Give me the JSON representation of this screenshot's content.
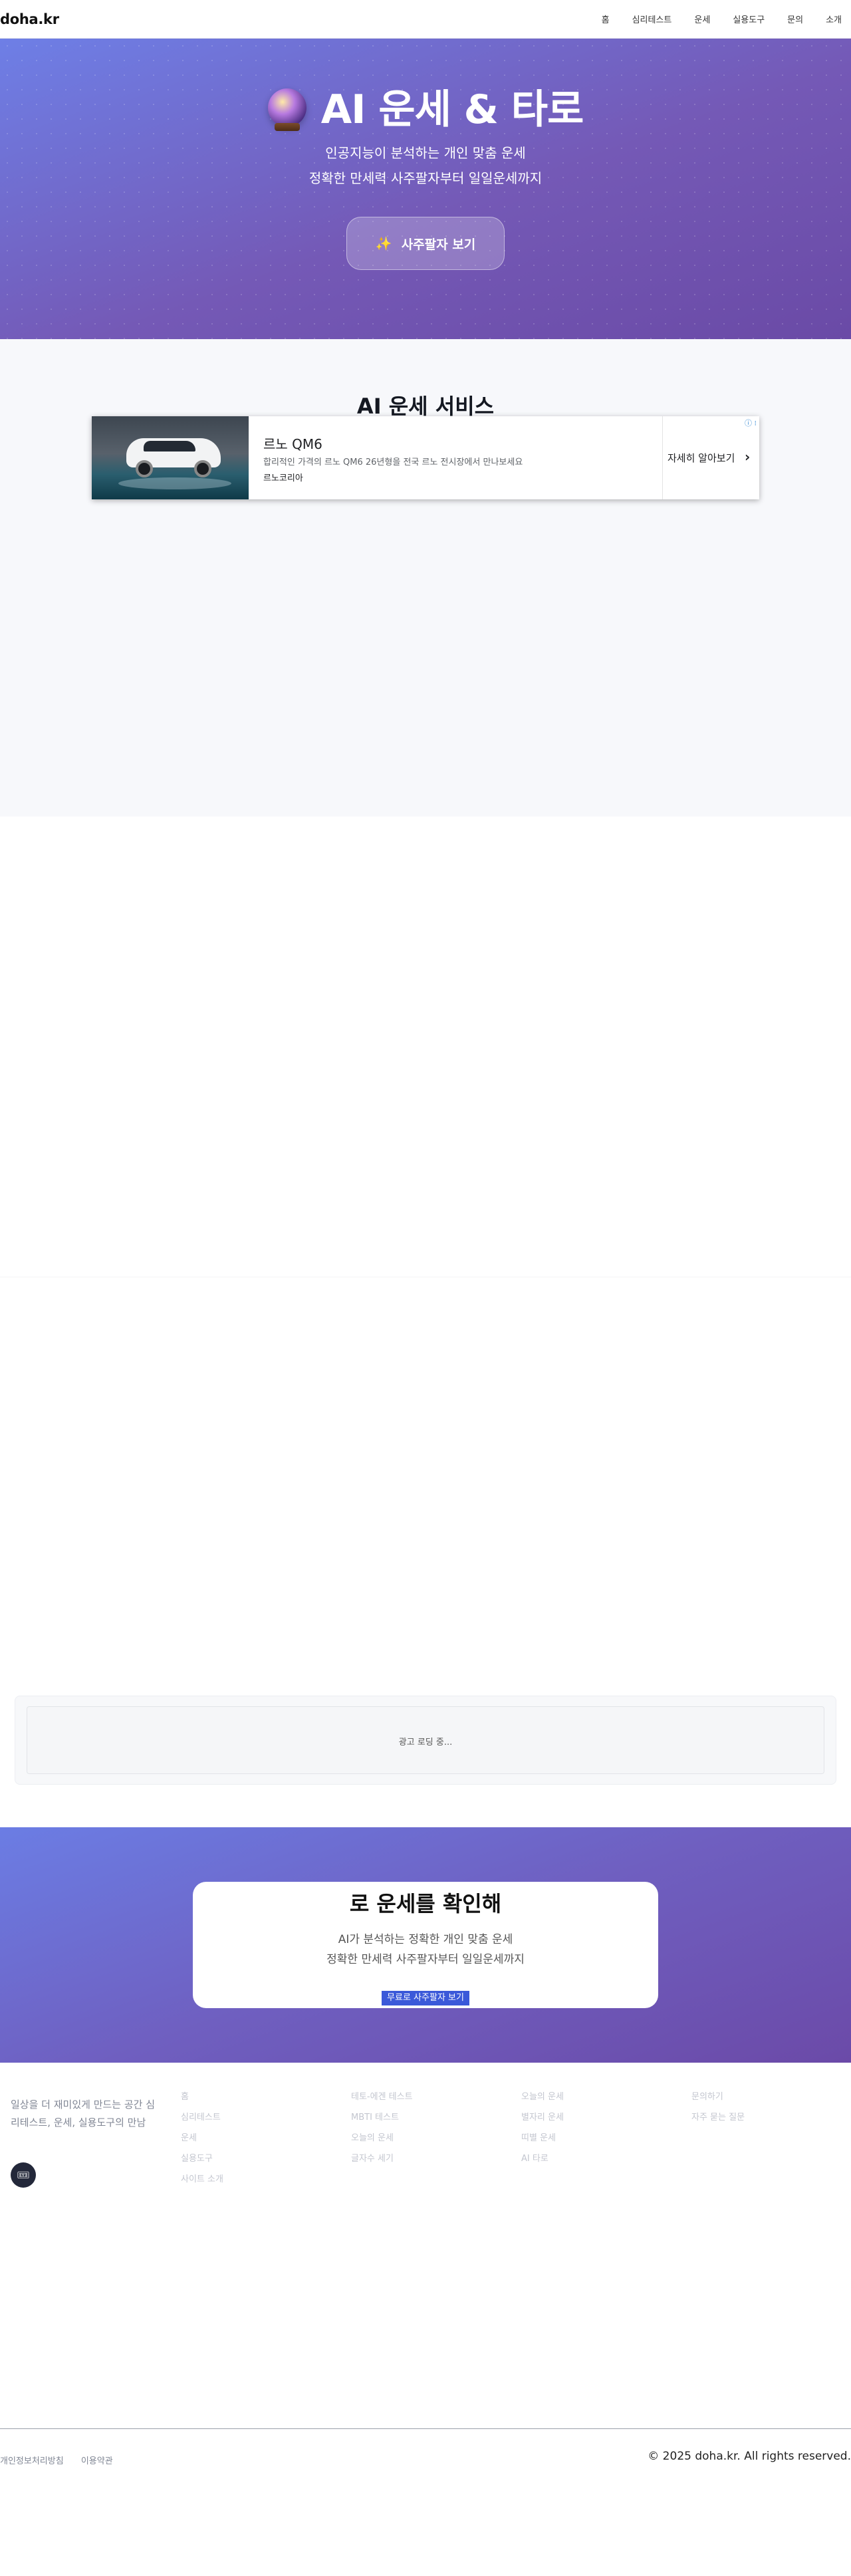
{
  "nav": {
    "logo": "doha.kr",
    "items": [
      "홈",
      "심리테스트",
      "운세",
      "실용도구",
      "문의",
      "소개"
    ]
  },
  "hero": {
    "icon": "crystal-ball-icon",
    "title": "AI 운세 & 타로",
    "subtitle_line1": "인공지능이 분석하는 개인 맞춤 운세",
    "subtitle_line2": "정확한 만세력 사주팔자부터 일일운세까지",
    "button_icon": "sparkles-icon",
    "button_label": "사주팔자 보기"
  },
  "services": {
    "title": "AI 운세 서비스"
  },
  "ad": {
    "title": "르노 QM6",
    "description": "합리적인 가격의 르노 QM6 26년형을 전국 르노 전시장에서 만나보세요",
    "advertiser": "르노코리아",
    "cta": "자세히 알아보기",
    "info_icon": "ad-info-icon"
  },
  "loading_ad": {
    "text": "광고 로딩 중..."
  },
  "cta": {
    "title": "로 운세를 확인해",
    "line1": "AI가 분석하는 정확한 개인 맞춤 운세",
    "line2": "정확한 만세력 사주팔자부터 일일운세까지",
    "button": "무료로 사주팔자 보기"
  },
  "footer": {
    "description": "일상을 더 재미있게 만드는 공간 심리테스트, 운세, 실용도구의 만남",
    "badge": "🎟",
    "col1": [
      "홈",
      "심리테스트",
      "운세",
      "실용도구",
      "사이트 소개"
    ],
    "col2": [
      "테토-에겐 테스트",
      "MBTI 테스트",
      "오늘의 운세",
      "글자수 세기"
    ],
    "col3": [
      "오늘의 운세",
      "별자리 운세",
      "띠별 운세",
      "AI 타로"
    ],
    "col4": [
      "문의하기",
      "자주 묻는 질문"
    ],
    "legal": [
      "개인정보처리방침",
      "이용약관"
    ],
    "copyright": "© 2025 doha.kr. All rights reserved."
  },
  "colors": {
    "hero_gradient_start": "#6e7fe6",
    "hero_gradient_end": "#6a4aa6",
    "cta_button": "#3b59d9"
  }
}
